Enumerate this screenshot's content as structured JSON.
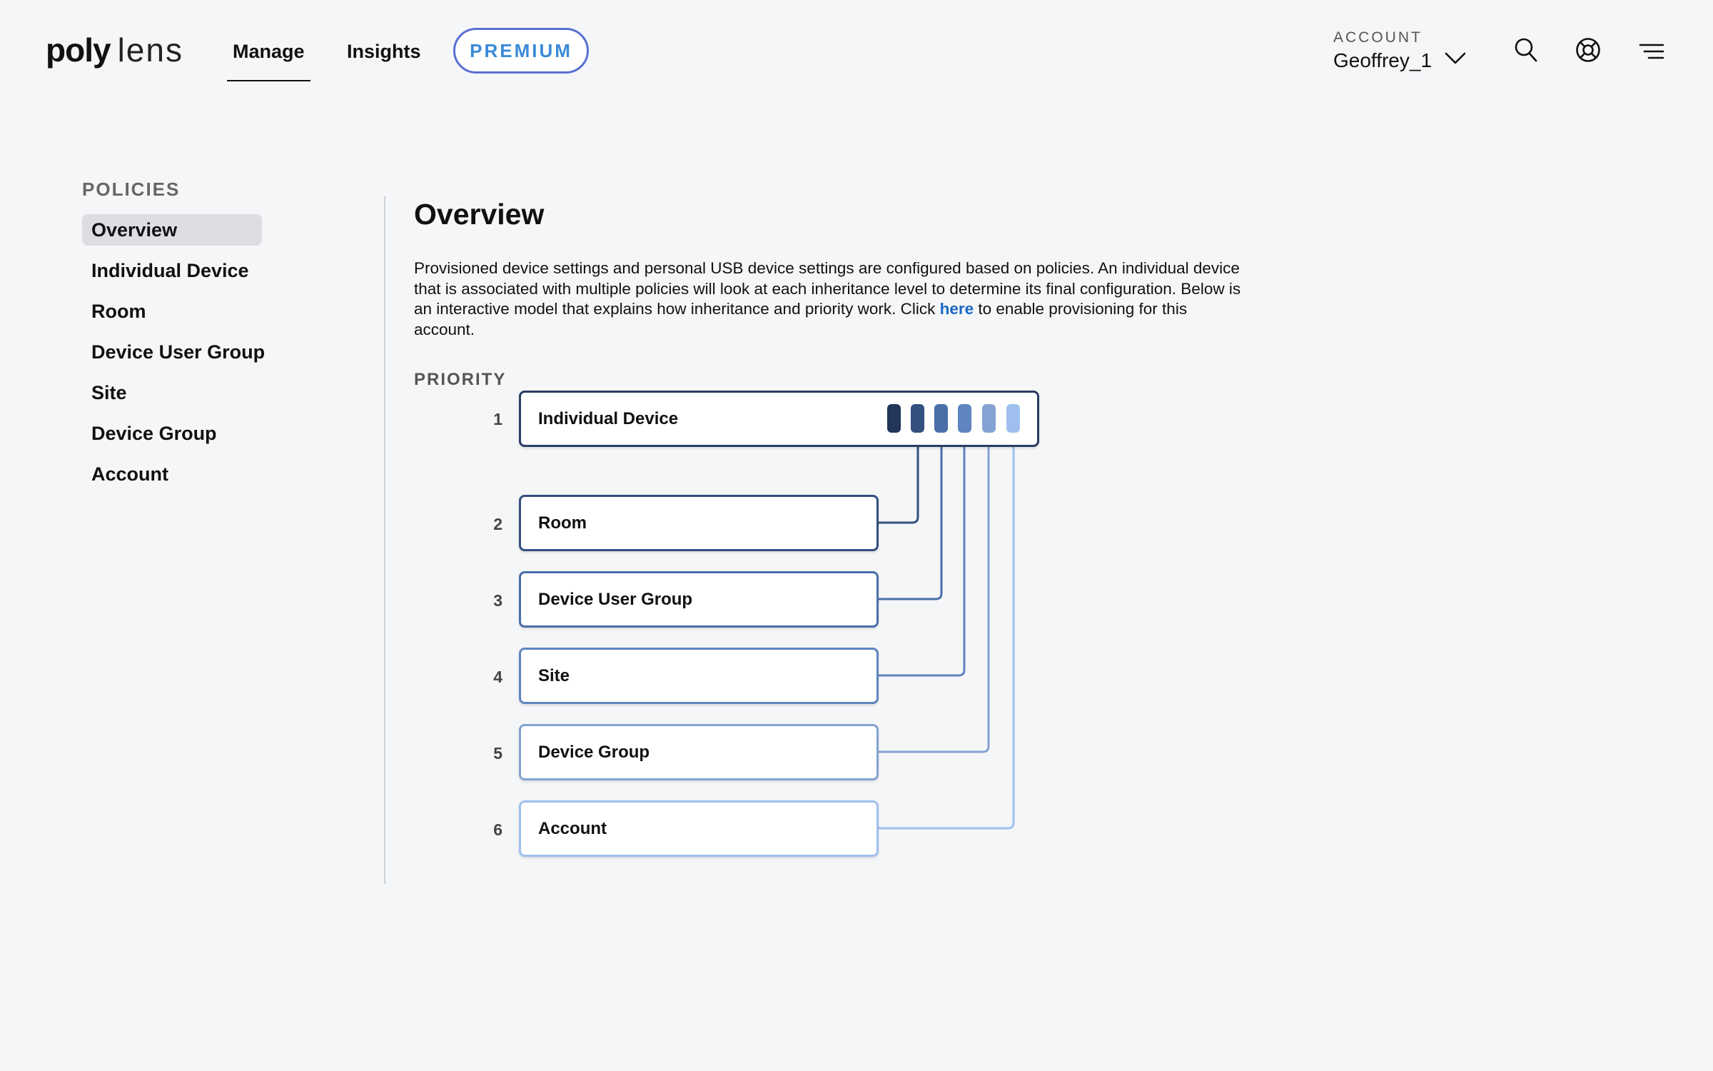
{
  "header": {
    "logo": {
      "poly": "poly",
      "lens": "lens"
    },
    "nav": [
      {
        "label": "Manage",
        "active": true
      },
      {
        "label": "Insights",
        "active": false
      }
    ],
    "premium_label": "PREMIUM",
    "account": {
      "caption": "ACCOUNT",
      "name": "Geoffrey_1"
    },
    "icons": [
      "chevron-down-icon",
      "search-icon",
      "help-lifebuoy-icon",
      "menu-icon"
    ]
  },
  "sidebar": {
    "heading": "POLICIES",
    "items": [
      {
        "label": "Overview",
        "active": true
      },
      {
        "label": "Individual Device"
      },
      {
        "label": "Room"
      },
      {
        "label": "Device User Group"
      },
      {
        "label": "Site"
      },
      {
        "label": "Device Group"
      },
      {
        "label": "Account"
      }
    ]
  },
  "main": {
    "title": "Overview",
    "description_before": "Provisioned device settings and personal USB device settings are configured based on policies. An individual device that is associated with multiple policies will look at each inheritance level to determine its final configuration. Below is an interactive model that explains how inheritance and priority work. Click ",
    "link_text": "here",
    "description_after": " to enable provisioning for this account.",
    "priority_label": "PRIORITY",
    "levels": [
      {
        "num": "1",
        "label": "Individual Device",
        "color": "#2a3e64"
      },
      {
        "num": "2",
        "label": "Room",
        "color": "#33507f"
      },
      {
        "num": "3",
        "label": "Device User Group",
        "color": "#4a6fa8"
      },
      {
        "num": "4",
        "label": "Site",
        "color": "#5f84bf"
      },
      {
        "num": "5",
        "label": "Device Group",
        "color": "#85a3d2"
      },
      {
        "num": "6",
        "label": "Account",
        "color": "#9fc0ef"
      }
    ],
    "inheritance_colors": [
      "#22355a",
      "#33507f",
      "#4a6fa8",
      "#5f84bf",
      "#85a3d2",
      "#9fc0ef"
    ]
  }
}
